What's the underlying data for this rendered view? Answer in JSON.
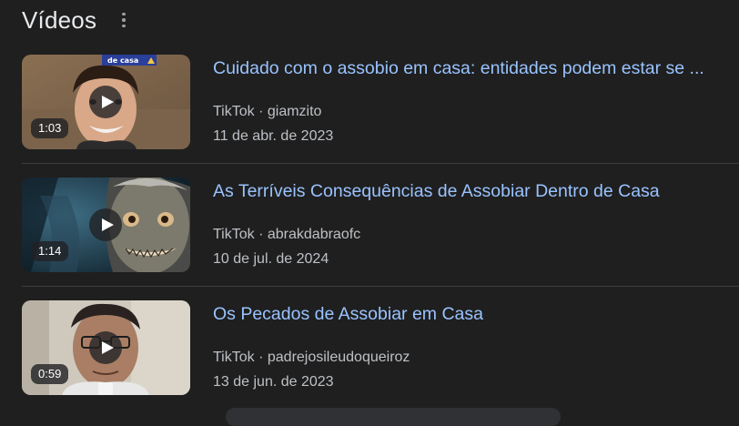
{
  "section": {
    "title": "Vídeos",
    "more_icon": "more-vert-icon"
  },
  "videos": [
    {
      "title": "Cuidado com o assobio em casa: entidades podem estar se ...",
      "source": "TikTok",
      "separator": "·",
      "author": "giamzito",
      "date": "11 de abr. de 2023",
      "duration": "1:03",
      "thumb_caption": "de casa"
    },
    {
      "title": "As Terríveis Consequências de Assobiar Dentro de Casa",
      "source": "TikTok",
      "separator": "·",
      "author": "abrakdabraofc",
      "date": "10 de jul. de 2024",
      "duration": "1:14"
    },
    {
      "title": "Os Pecados de Assobiar em Casa",
      "source": "TikTok",
      "separator": "·",
      "author": "padrejosileudoqueiroz",
      "date": "13 de jun. de 2023",
      "duration": "0:59"
    }
  ],
  "colors": {
    "background": "#1f1f1f",
    "title_link": "#99c3ff",
    "meta_text": "#bdc1c6",
    "divider": "#3c4043"
  }
}
